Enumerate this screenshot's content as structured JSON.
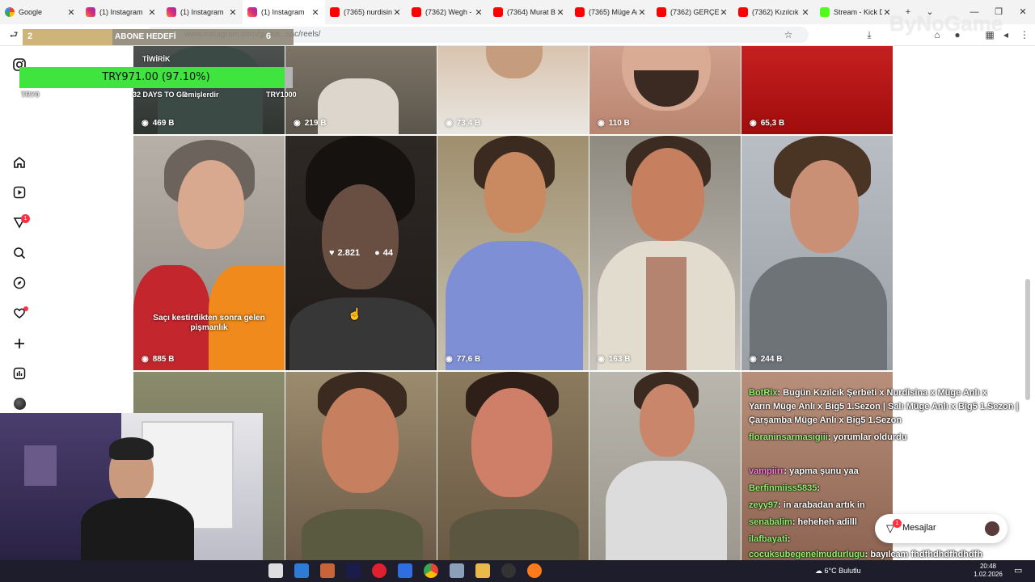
{
  "browser": {
    "tabs": [
      {
        "label": "Google",
        "icon": "google-icon"
      },
      {
        "label": "(1) Instagram",
        "icon": "instagram-icon"
      },
      {
        "label": "(1) Instagram",
        "icon": "instagram-icon"
      },
      {
        "label": "(1) Instagram",
        "icon": "instagram-icon",
        "active": true
      },
      {
        "label": "(7365) nurdisina -",
        "icon": "youtube-icon"
      },
      {
        "label": "(7362) Wegh - Sa",
        "icon": "youtube-icon"
      },
      {
        "label": "(7364) Murat Boz",
        "icon": "youtube-icon"
      },
      {
        "label": "(7365) Müge Anlı",
        "icon": "youtube-icon"
      },
      {
        "label": "(7362) GERÇEK F",
        "icon": "youtube-icon"
      },
      {
        "label": "(7362) Kızılcık Şer",
        "icon": "youtube-icon"
      },
      {
        "label": "Stream - Kick Das",
        "icon": "kick-icon"
      }
    ],
    "new_tab": "+",
    "url": "www.instagram.com/gurka...sac/reels/"
  },
  "overlay": {
    "subscriber_goal": {
      "current": "2",
      "label": "ABONE HEDEFİ",
      "target": "6",
      "progress": 0.33
    },
    "donation": {
      "text": "TRY971.00 (97.10%)",
      "progress": 0.971,
      "left_label": "TRY0",
      "right_label": "TRY1000",
      "days": "32 DAYS TO GO"
    },
    "twirik": "TİWİRİK",
    "bagis_text": "lemişlerdir"
  },
  "reels": [
    {
      "views": "469 B"
    },
    {
      "views": "219 B"
    },
    {
      "views": "73,4 B"
    },
    {
      "views": "110 B"
    },
    {
      "views": "65,3 B"
    },
    {
      "views": "885 B",
      "caption": "Saçı kestirdikten sonra gelen pişmanlık"
    },
    {
      "likes": "2.821",
      "comments": "44"
    },
    {
      "views": "77,6 B"
    },
    {
      "views": "163 B"
    },
    {
      "views": "244 B"
    },
    {},
    {},
    {},
    {},
    {}
  ],
  "chat": [
    {
      "user": "BotRix",
      "text": ": Bugün Kızılcık Şerbeti x Nurdisina x Müge Anlı x"
    },
    {
      "user": "",
      "text": "Yarın Müge Anlı x Big5 1.Sezon | Salı Müge Anlı x Big5 1.Sezon |"
    },
    {
      "user": "",
      "text": "Çarşamba Müge Anlı x Big5 1.Sezon"
    },
    {
      "user": "floraninsarmasigiii",
      "text": ": yorumlar oldurdu"
    },
    {
      "user": "vampiirr",
      "text": ": yapma şunu yaa"
    },
    {
      "user": "Berfinmiiss5835",
      "text": ":"
    },
    {
      "user": "zeyy97",
      "text": ": in arabadan artık in"
    },
    {
      "user": "senabalim",
      "text": ": heheheh adilll"
    },
    {
      "user": "ilafbayati",
      "text": ":"
    },
    {
      "user": "cocuksubegenelmudurlugu",
      "text": ": bayılcam fhdfhdhdfhdhdfh"
    }
  ],
  "messages_button": {
    "label": "Mesajlar",
    "badge": "1"
  },
  "sidebar": {
    "notification_badge": "1"
  },
  "taskbar": {
    "weather": "6°C Bulutlu",
    "time": "20:48",
    "date": "1.02.2026"
  },
  "watermark": "ByNoGame",
  "colors": {
    "donation_fill": "#3fe43f",
    "goal_fill": "#c9ac6a",
    "badge": "#ff3040",
    "chat_name": "#8ef26a"
  }
}
